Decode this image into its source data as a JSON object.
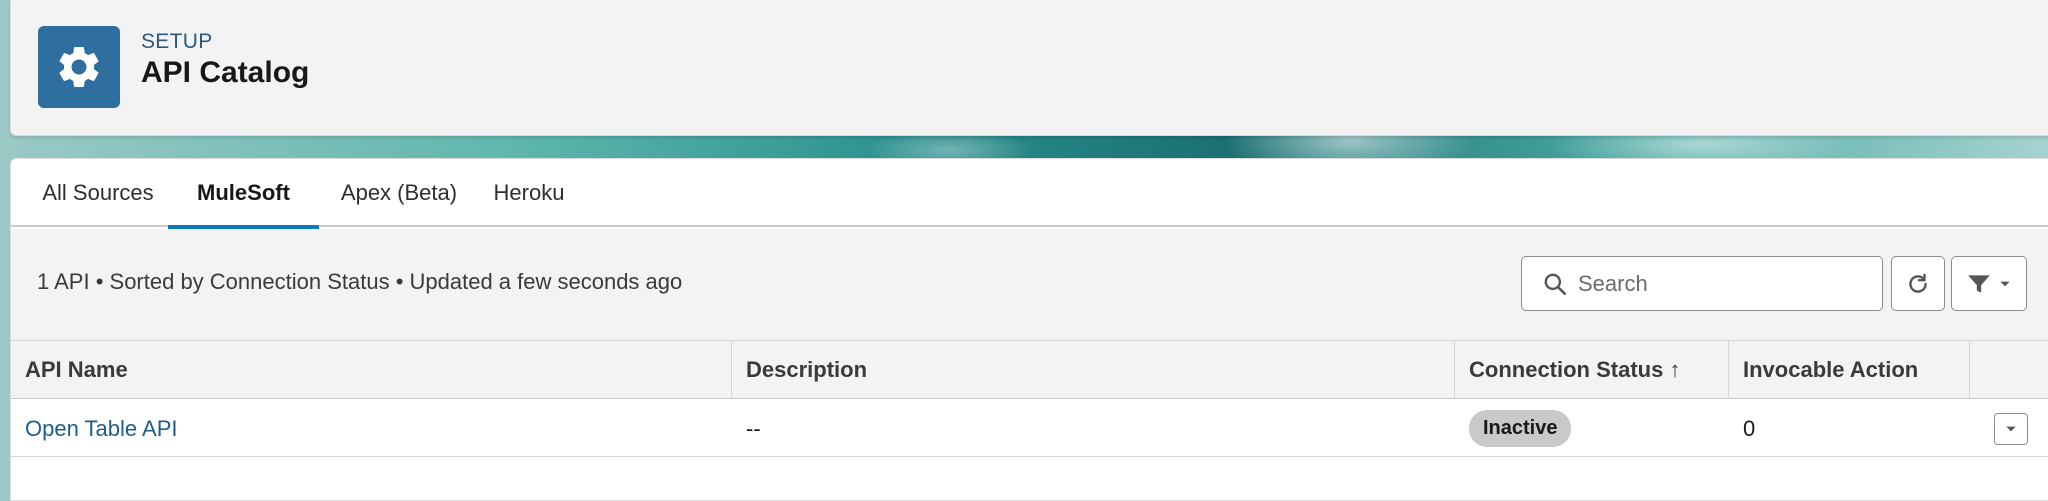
{
  "header": {
    "eyebrow": "SETUP",
    "title": "API Catalog",
    "icon": "gear-icon",
    "icon_color": "#2e6fa0"
  },
  "tabs": [
    {
      "label": "All Sources",
      "active": false
    },
    {
      "label": "MuleSoft",
      "active": true
    },
    {
      "label": "Apex (Beta)",
      "active": false
    },
    {
      "label": "Heroku",
      "active": false
    }
  ],
  "toolbar": {
    "summary": "1 API • Sorted by Connection Status • Updated a few seconds ago",
    "search": {
      "placeholder": "Search",
      "value": ""
    },
    "refresh_icon": "refresh-icon",
    "filter_icon": "filter-icon"
  },
  "table": {
    "columns": [
      "API Name",
      "Description",
      "Connection Status ↑",
      "Invocable Action"
    ],
    "rows": [
      {
        "api_name": "Open Table API",
        "description": "--",
        "connection_status": "Inactive",
        "invocable_action": "0"
      }
    ]
  },
  "colors": {
    "accent": "#0b7bb5",
    "link": "#1e5f8a",
    "badge_bg": "#c9c9c9"
  }
}
